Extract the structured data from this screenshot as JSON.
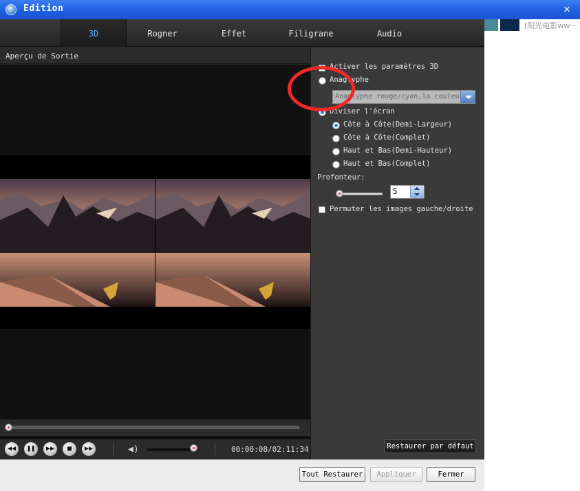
{
  "window": {
    "title": "Edition"
  },
  "background": {
    "partial_text": "[阳光电影ww···"
  },
  "tabs": [
    {
      "label": "3D",
      "active": true
    },
    {
      "label": "Rogner",
      "active": false
    },
    {
      "label": "Effet",
      "active": false
    },
    {
      "label": "Filigrane",
      "active": false
    },
    {
      "label": "Audio",
      "active": false
    }
  ],
  "preview": {
    "header": "Aperçu de Sortie",
    "time": "00:00:08/02:11:34",
    "progress_fraction": 0.0,
    "volume_fraction": 1.0
  },
  "settings_3d": {
    "enable_label": "Activer les paramètres 3D",
    "enable_checked": true,
    "anaglyph_label": "Anaglyphe",
    "anaglyph_selected": false,
    "anaglyph_dropdown_value": "Anaglyphe rouge/cyan,la couleur",
    "split_label": "Diviser l'écran",
    "split_selected": true,
    "split_options": [
      {
        "label": "Côte à Côte(Demi-Largeur)",
        "selected": true
      },
      {
        "label": "Côte à Côte(Complet)",
        "selected": false
      },
      {
        "label": "Haut et Bas(Demi-Hauteur)",
        "selected": false
      },
      {
        "label": "Haut et Bas(Complet)",
        "selected": false
      }
    ],
    "depth_label": "Profonteur:",
    "depth_value": "5",
    "swap_label": "Permuter les images gauche/droite",
    "swap_checked": false,
    "restore_default_label": "Restaurer par défaut"
  },
  "footer": {
    "reset_all": "Tout Restaurer",
    "apply": "Appliquer",
    "close": "Fermer"
  },
  "colors": {
    "titlebar": "#1f5fe0",
    "active_tab": "#5ab0ff",
    "panel": "#3a3a3a",
    "annotation": "#f02828"
  }
}
